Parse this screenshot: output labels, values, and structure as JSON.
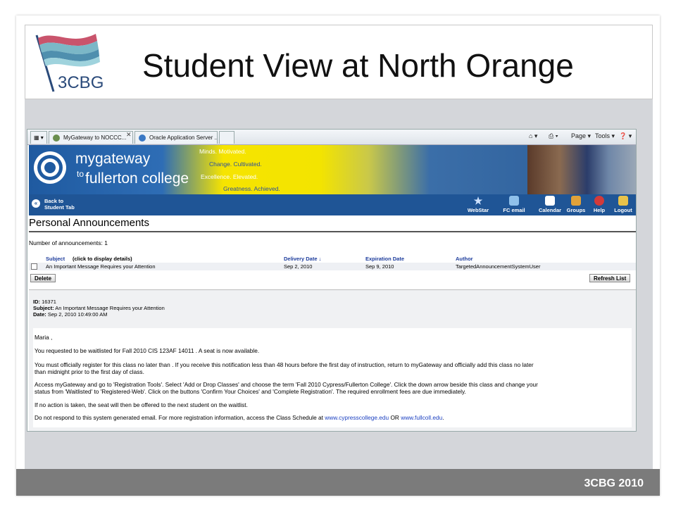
{
  "slide": {
    "title": "Student View at North Orange",
    "logo_text": "3CBG",
    "footer": "3CBG 2010"
  },
  "browser": {
    "tabs": [
      {
        "label": "MyGateway to NOCCC..."
      },
      {
        "label": "Oracle Application Server ..."
      }
    ],
    "toolbar": {
      "page_label": "Page",
      "tools_label": "Tools"
    }
  },
  "site": {
    "brand_line1": "mygateway",
    "brand_to": "to",
    "brand_line2": "fullerton college",
    "motto": [
      "Minds. Motivated.",
      "Change. Cultivated.",
      "Excellence. Elevated.",
      "Greatness. Achieved."
    ],
    "nav": {
      "back": [
        "Back to",
        "Student Tab"
      ],
      "items": [
        "WebStar",
        "FC email",
        "Calendar",
        "Groups",
        "Help",
        "Logout"
      ]
    }
  },
  "announcements": {
    "heading": "Personal Announcements",
    "count_text": "Number of announcements: 1",
    "columns": {
      "subject": "Subject",
      "subject_hint": "(click to display details)",
      "delivery": "Delivery Date ↓",
      "expiration": "Expiration Date",
      "author": "Author"
    },
    "rows": [
      {
        "subject": "An Important Message Requires your Attention",
        "delivery": "Sep 2, 2010",
        "expiration": "Sep 9, 2010",
        "author": "TargetedAnnouncementSystemUser"
      }
    ],
    "delete_label": "Delete",
    "refresh_label": "Refresh List"
  },
  "detail": {
    "id_label": "ID:",
    "id_value": "16371",
    "subject_label": "Subject:",
    "subject_value": "An Important Message Requires your Attention",
    "date_label": "Date:",
    "date_value": "Sep 2, 2010 10:49:00 AM",
    "greeting": "Maria ,",
    "p1": "You requested to be waitlisted for Fall 2010 CIS 123AF 14011 . A seat is now available.",
    "p2a": "You must officially register for this class no later than .  If you receive this notification less than 48 hours before the first day of instruction, return to myGateway and officially add this class no later",
    "p2b": "than midnight prior to the first day of class.",
    "p3a": "Access myGateway and go to 'Registration Tools'. Select 'Add or Drop Classes' and choose the term 'Fall 2010 Cypress/Fullerton College'. Click the down arrow beside this class and change your",
    "p3b": "status from 'Waitlisted' to 'Registered-Web'.  Click on the buttons 'Confirm Your Choices' and 'Complete Registration'. The required enrollment fees are due immediately.",
    "p4": "If no action is taken, the seat will then be offered to the next student on the waitlist.",
    "p5_pre": "Do not respond to this system generated email. For more registration information, access the Class Schedule at ",
    "p5_link1": "www.cypresscollege.edu",
    "p5_mid": " OR ",
    "p5_link2": "www.fullcoll.edu",
    "p5_end": "."
  }
}
